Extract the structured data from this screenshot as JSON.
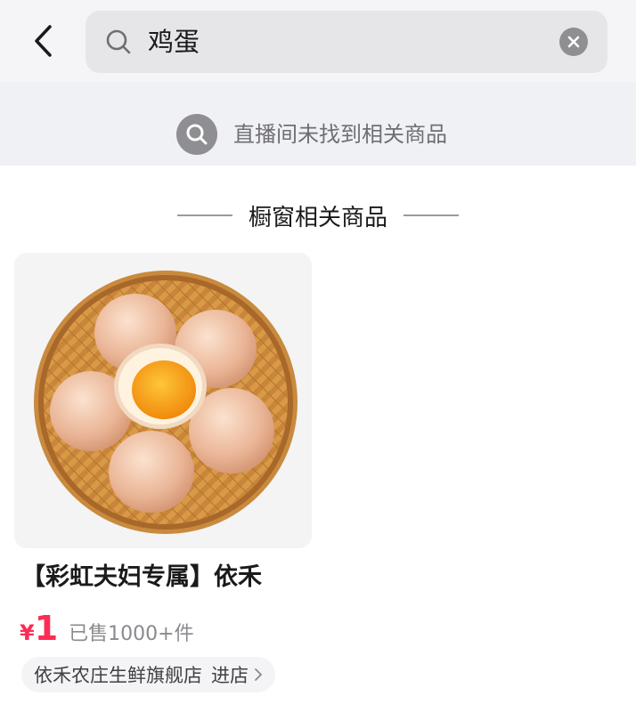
{
  "search": {
    "query": "鸡蛋"
  },
  "notice": {
    "text": "直播间未找到相关商品"
  },
  "section": {
    "title": "橱窗相关商品"
  },
  "product": {
    "title": "【彩虹夫妇专属】依禾",
    "price_symbol": "¥",
    "price": "1",
    "sold": "已售1000+件",
    "shop_name": "依禾农庄生鲜旗舰店",
    "shop_enter": "进店"
  },
  "colors": {
    "accent": "#fe2c55",
    "icon_gray": "#8e8e93"
  }
}
